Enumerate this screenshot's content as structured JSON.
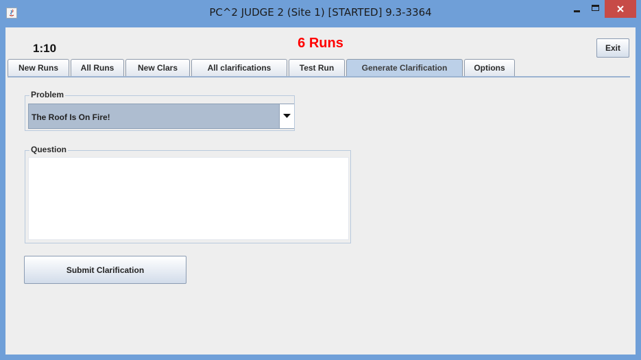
{
  "window": {
    "title": "PC^2 JUDGE 2 (Site 1) [STARTED] 9.3-3364",
    "colors": {
      "frame": "#6f9fd8",
      "close": "#c74b47",
      "client": "#eeeeee"
    }
  },
  "header": {
    "timer": "1:10",
    "exit_label": "Exit",
    "runs_count": "6 Runs",
    "runs_color": "#ff0000"
  },
  "tabs": [
    {
      "label": "New Runs",
      "active": false
    },
    {
      "label": "All Runs",
      "active": false
    },
    {
      "label": "New Clars",
      "active": false
    },
    {
      "label": "All clarifications",
      "active": false
    },
    {
      "label": "Test Run",
      "active": false
    },
    {
      "label": "Generate Clarification",
      "active": true
    },
    {
      "label": "Options",
      "active": false
    }
  ],
  "form": {
    "problem_label": "Problem",
    "problem_value": "The Roof Is On Fire!",
    "question_label": "Question",
    "question_value": "",
    "submit_label": "Submit Clarification"
  }
}
